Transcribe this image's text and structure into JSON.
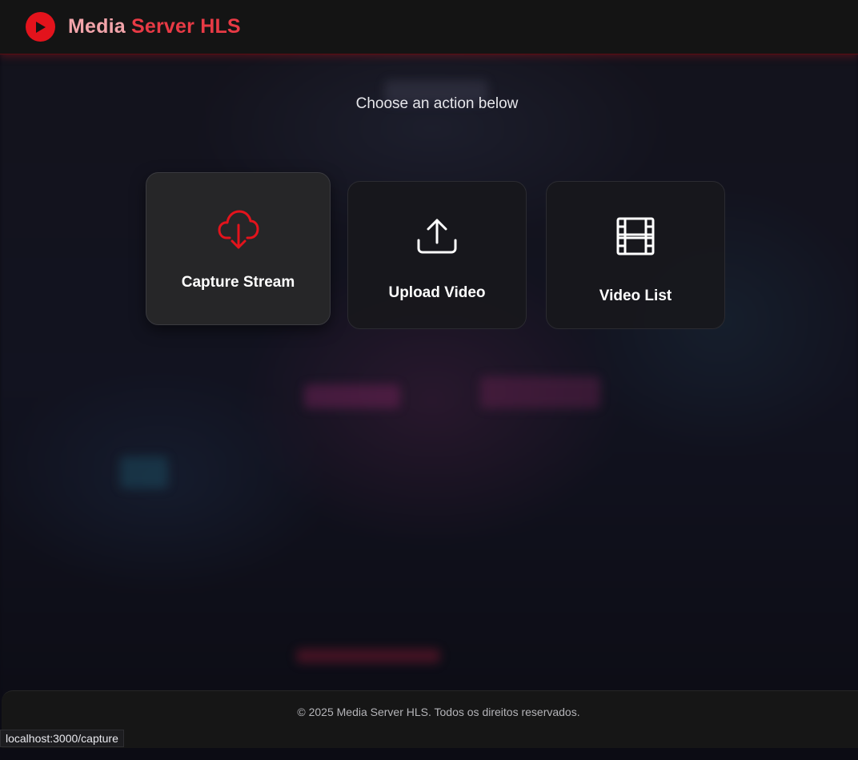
{
  "header": {
    "brand_part1": "Media",
    "brand_part2": "Server HLS",
    "logo_icon": "play-circle-icon",
    "accent_color": "#e3131c"
  },
  "main": {
    "subtitle": "Choose an action below",
    "actions": [
      {
        "label": "Capture Stream",
        "icon": "cloud-download-icon",
        "icon_color": "#e3131c"
      },
      {
        "label": "Upload Video",
        "icon": "upload-icon",
        "icon_color": "#ffffff"
      },
      {
        "label": "Video List",
        "icon": "film-strip-icon",
        "icon_color": "#ffffff"
      }
    ]
  },
  "footer": {
    "text": "© 2025 Media Server HLS. Todos os direitos reservados."
  },
  "status_bar": {
    "url": "localhost:3000/capture"
  }
}
